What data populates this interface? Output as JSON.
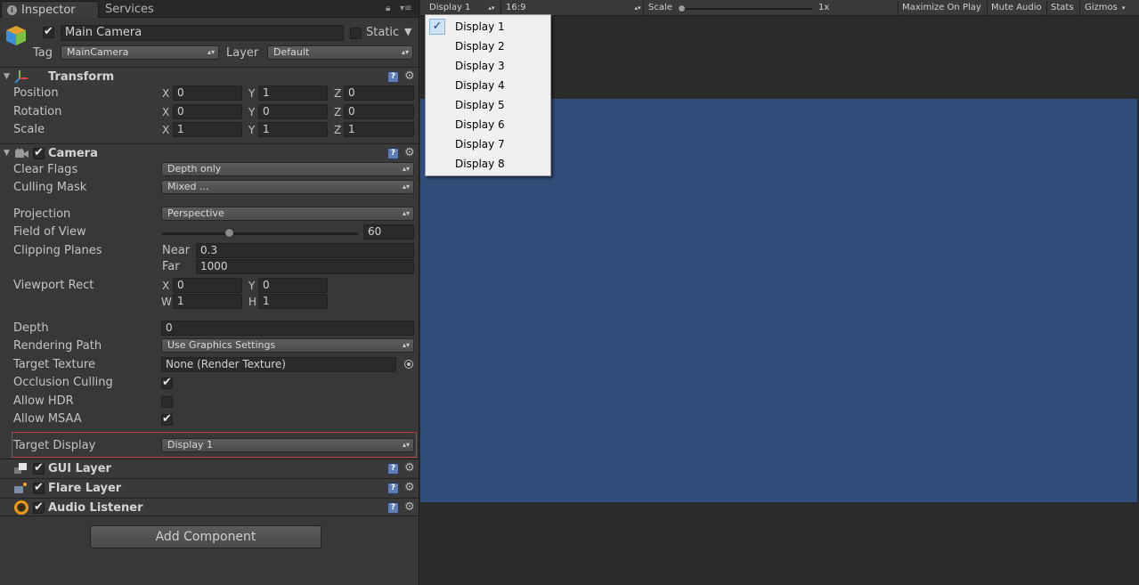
{
  "tabs": {
    "inspector": "Inspector",
    "services": "Services"
  },
  "object": {
    "name": "Main Camera",
    "static_label": "Static",
    "tag_label": "Tag",
    "tag_value": "MainCamera",
    "layer_label": "Layer",
    "layer_value": "Default",
    "active": true,
    "static": false
  },
  "transform": {
    "title": "Transform",
    "position": {
      "label": "Position",
      "x": "0",
      "y": "1",
      "z": "0"
    },
    "rotation": {
      "label": "Rotation",
      "x": "0",
      "y": "0",
      "z": "0"
    },
    "scale": {
      "label": "Scale",
      "x": "1",
      "y": "1",
      "z": "1"
    },
    "axes": {
      "x": "X",
      "y": "Y",
      "z": "Z"
    }
  },
  "camera": {
    "title": "Camera",
    "enabled": true,
    "clear_flags": {
      "label": "Clear Flags",
      "value": "Depth only"
    },
    "culling_mask": {
      "label": "Culling Mask",
      "value": "Mixed ..."
    },
    "projection": {
      "label": "Projection",
      "value": "Perspective"
    },
    "fov": {
      "label": "Field of View",
      "value": "60",
      "fraction": 0.34
    },
    "clipping": {
      "label": "Clipping Planes",
      "near_label": "Near",
      "near": "0.3",
      "far_label": "Far",
      "far": "1000"
    },
    "viewport": {
      "label": "Viewport Rect",
      "x_label": "X",
      "x": "0",
      "y_label": "Y",
      "y": "0",
      "w_label": "W",
      "w": "1",
      "h_label": "H",
      "h": "1"
    },
    "depth": {
      "label": "Depth",
      "value": "0"
    },
    "rendering_path": {
      "label": "Rendering Path",
      "value": "Use Graphics Settings"
    },
    "target_texture": {
      "label": "Target Texture",
      "value": "None (Render Texture)"
    },
    "occlusion": {
      "label": "Occlusion Culling",
      "checked": true
    },
    "hdr": {
      "label": "Allow HDR",
      "checked": false
    },
    "msaa": {
      "label": "Allow MSAA",
      "checked": true
    },
    "target_display": {
      "label": "Target Display",
      "value": "Display 1"
    }
  },
  "components": [
    {
      "title": "GUI Layer",
      "enabled": true
    },
    {
      "title": "Flare Layer",
      "enabled": true
    },
    {
      "title": "Audio Listener",
      "enabled": true
    }
  ],
  "add_component": "Add Component",
  "gameview": {
    "display": "Display 1",
    "aspect": "16:9",
    "scale_label": "Scale",
    "scale_value": "1x",
    "maximize": "Maximize On Play",
    "mute": "Mute Audio",
    "stats": "Stats",
    "gizmos": "Gizmos"
  },
  "display_menu": {
    "selected": "Display 1",
    "items": [
      "Display 1",
      "Display 2",
      "Display 3",
      "Display 4",
      "Display 5",
      "Display 6",
      "Display 7",
      "Display 8"
    ]
  },
  "colors": {
    "viewport": "#314d7a",
    "highlight": "#c33c3c",
    "panel": "#383838"
  }
}
